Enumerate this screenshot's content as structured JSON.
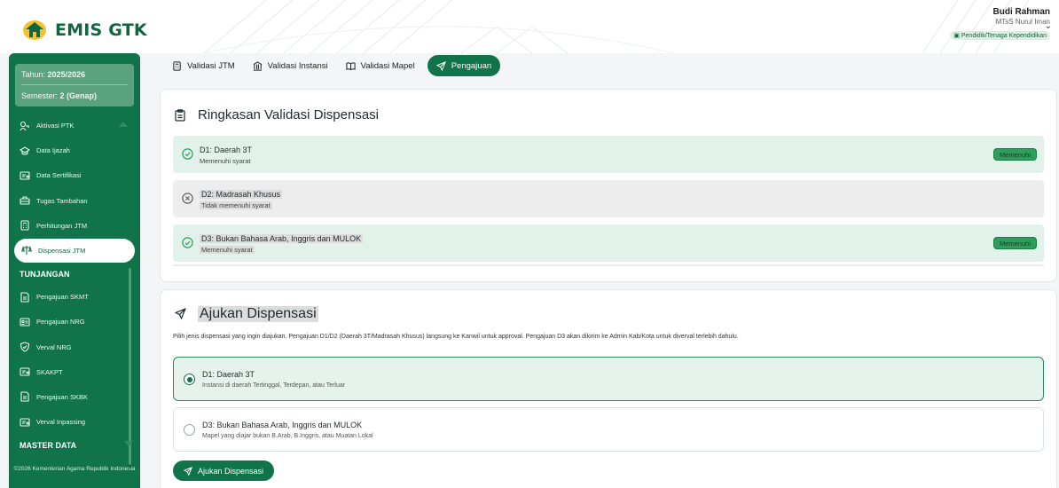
{
  "app": {
    "name": "EMIS GTK"
  },
  "user": {
    "name": "Budi Rahman",
    "org": "MTsS Nurul Iman",
    "role": "Pendidik/Tenaga Kependidikan"
  },
  "sidebar": {
    "year_label": "Tahun:",
    "year_value": "2025/2026",
    "semester_label": "Semester:",
    "semester_value": "2 (Genap)",
    "items": [
      {
        "label": "Aktivasi PTK",
        "icon": "user-key-icon"
      },
      {
        "label": "Data Ijazah",
        "icon": "graduation-cap-icon"
      },
      {
        "label": "Data Sertifikasi",
        "icon": "certificate-icon"
      },
      {
        "label": "Tugas Tambahan",
        "icon": "briefcase-icon"
      },
      {
        "label": "Perhitungan JTM",
        "icon": "calculator-icon"
      },
      {
        "label": "Dispensasi JTM",
        "icon": "scale-icon",
        "active": true
      }
    ],
    "section_tunjangan": "TUNJANGAN",
    "items2": [
      {
        "label": "Pengajuan SKMT",
        "icon": "document-icon"
      },
      {
        "label": "Pengajuan NRG",
        "icon": "id-card-icon"
      },
      {
        "label": "Verval NRG",
        "icon": "shield-check-icon"
      },
      {
        "label": "SKAKPT",
        "icon": "certificate-icon"
      },
      {
        "label": "Pengajuan SKBK",
        "icon": "document-icon"
      },
      {
        "label": "Verval Inpassing",
        "icon": "certificate-icon"
      }
    ],
    "section_master": "MASTER DATA",
    "footer": "©2026 Kementerian Agama Republik Indonesia"
  },
  "tabs": [
    {
      "label": "Validasi JTM",
      "icon": "calculator-icon"
    },
    {
      "label": "Validasi Instansi",
      "icon": "building-icon"
    },
    {
      "label": "Validasi Mapel",
      "icon": "book-icon"
    },
    {
      "label": "Pengajuan",
      "icon": "send-icon",
      "active": true
    }
  ],
  "summary": {
    "title": "Ringkasan Validasi Dispensasi",
    "rows": [
      {
        "title": "D1: Daerah 3T",
        "status": "Memenuhi syarat",
        "badge": "Memenuhi",
        "ok": true
      },
      {
        "title": "D2: Madrasah Khusus",
        "status": "Tidak memenuhi syarat",
        "ok": false
      },
      {
        "title": "D3: Bukan Bahasa Arab, Inggris dan MULOK",
        "status": "Memenuhi syarat",
        "badge": "Memenuhi",
        "ok": true
      }
    ]
  },
  "submit_section": {
    "title": "Ajukan Dispensasi",
    "description": "Pilih jenis dispensasi yang ingin diajukan. Pengajuan D1/D2 (Daerah 3T/Madrasah Khusus) langsung ke Kanwil untuk approval. Pengajuan D3 akan dikirim ke Admin Kab/Kota untuk diverval terlebih dahulu.",
    "options": [
      {
        "title": "D1: Daerah 3T",
        "desc": "Instansi di daerah Tertinggal, Terdepan, atau Terluar",
        "selected": true
      },
      {
        "title": "D3: Bukan Bahasa Arab, Inggris dan MULOK",
        "desc": "Mapel yang diajar bukan B.Arab, B.Inggris, atau Muatan Lokal",
        "selected": false
      }
    ],
    "button": "Ajukan Dispensasi"
  },
  "colors": {
    "brand": "#10734a",
    "success": "#2f9e5d",
    "success_bg": "#e2f2ea"
  }
}
